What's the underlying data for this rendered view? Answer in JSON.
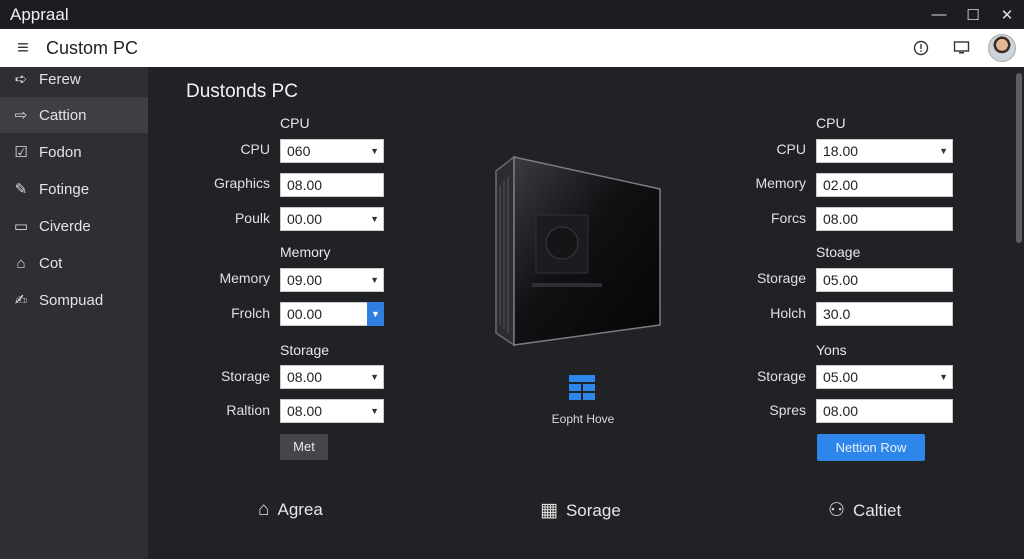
{
  "window": {
    "title": "Appraal",
    "minimize": "—",
    "maximize": "☐",
    "close": "✕"
  },
  "header": {
    "menu_icon": "hamburger-icon",
    "title": "Custom PC"
  },
  "sidebar": {
    "items": [
      {
        "label": "Ferew",
        "icon": "➪"
      },
      {
        "label": "Cattion",
        "icon": "⇨"
      },
      {
        "label": "Fodon",
        "icon": "☑"
      },
      {
        "label": "Fotinge",
        "icon": "✎"
      },
      {
        "label": "Civerde",
        "icon": "▭"
      },
      {
        "label": "Cot",
        "icon": "⌂"
      },
      {
        "label": "Sompuad",
        "icon": "✍"
      }
    ]
  },
  "main": {
    "title": "Dustonds PC",
    "left": {
      "sections": [
        "CPU",
        "Memory",
        "Storage"
      ],
      "rows": [
        {
          "label": "CPU",
          "value": "060",
          "dropdown": true
        },
        {
          "label": "Graphics",
          "value": "08.00",
          "dropdown": false
        },
        {
          "label": "Poulk",
          "value": "00.00",
          "dropdown": true
        },
        {
          "label": "Memory",
          "value": "09.00",
          "dropdown": true
        },
        {
          "label": "Frolch",
          "value": "00.00",
          "dropdown": true
        },
        {
          "label": "Storage",
          "value": "08.00",
          "dropdown": true
        },
        {
          "label": "Raltion",
          "value": "08.00",
          "dropdown": true
        }
      ],
      "button": "Met"
    },
    "right": {
      "sections": [
        "CPU",
        "Stoage",
        "Yons"
      ],
      "rows": [
        {
          "label": "CPU",
          "value": "18.00",
          "dropdown": true
        },
        {
          "label": "Memory",
          "value": "02.00",
          "dropdown": false
        },
        {
          "label": "Forcs",
          "value": "08.00",
          "dropdown": false
        },
        {
          "label": "Storage",
          "value": "05.00",
          "dropdown": false
        },
        {
          "label": "Holch",
          "value": "30.0",
          "dropdown": false
        },
        {
          "label": "Storage",
          "value": "05.00",
          "dropdown": true
        },
        {
          "label": "Spres",
          "value": "08.00",
          "dropdown": false
        }
      ],
      "button": "Nettion Row"
    },
    "center": {
      "label": "Eopht Hove"
    },
    "bottom": [
      {
        "label": "Agrea",
        "icon": "⌂"
      },
      {
        "label": "Sorage",
        "icon": "▦"
      },
      {
        "label": "Caltiet",
        "icon": "⚇"
      }
    ]
  },
  "colors": {
    "accent": "#2f86ea",
    "background": "#212226",
    "sidebar": "#2d2f33"
  }
}
